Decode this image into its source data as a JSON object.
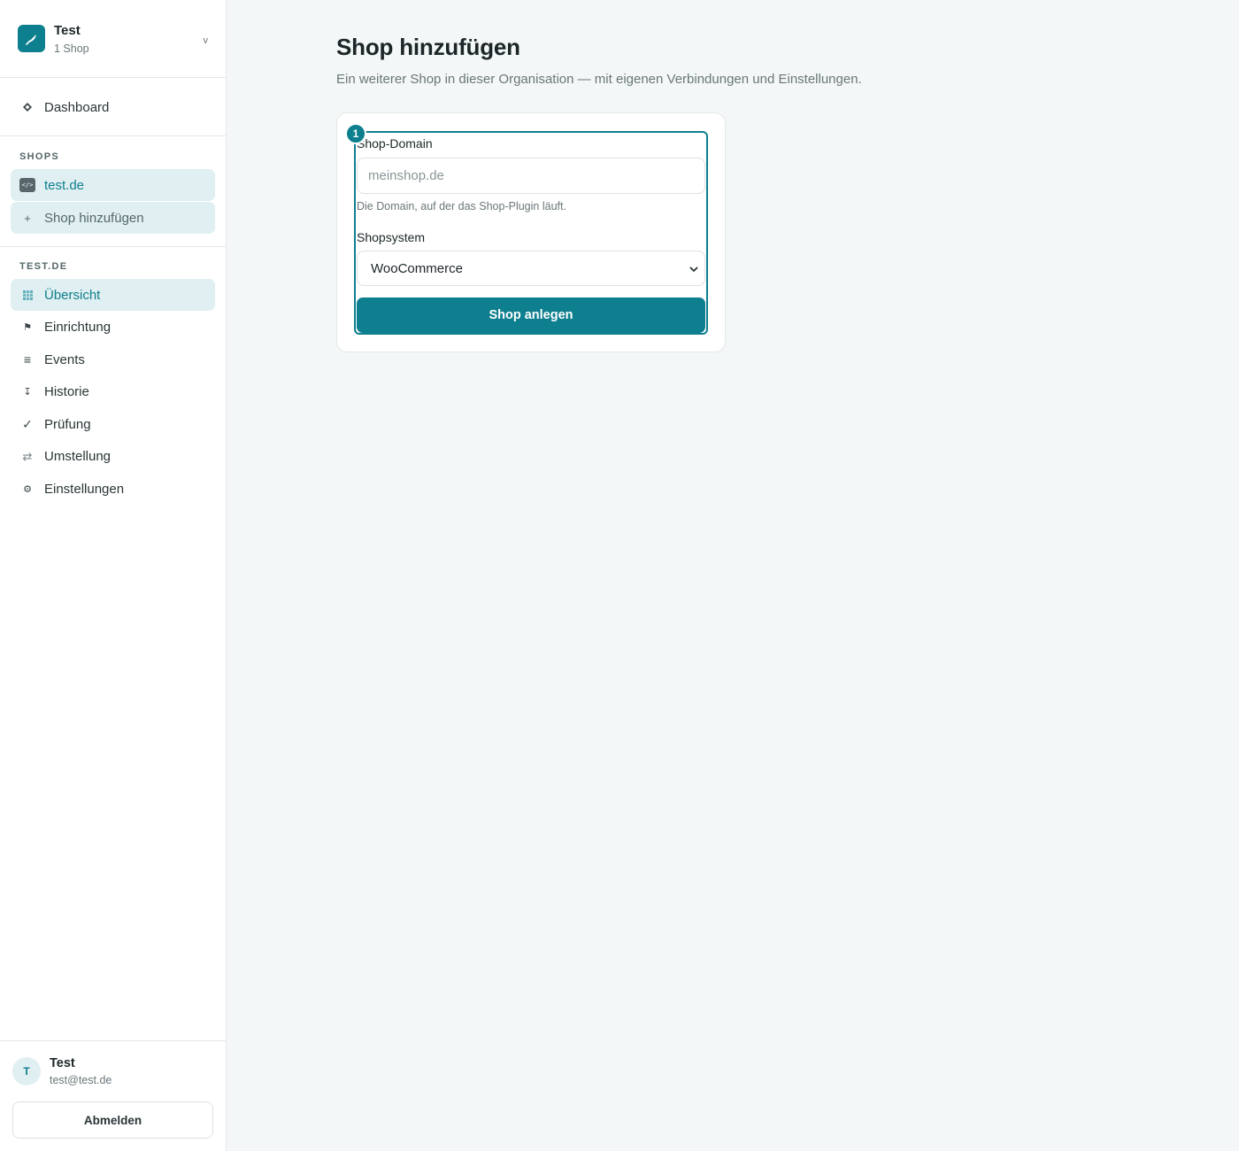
{
  "org": {
    "name": "Test",
    "subtitle": "1 Shop",
    "chevron": "v"
  },
  "nav": {
    "dashboard": {
      "label": "Dashboard",
      "icon": "diamond-icon"
    }
  },
  "shops": {
    "section_label": "SHOPS",
    "items": [
      {
        "label": "test.de",
        "icon": "code-icon",
        "icon_text": "</>"
      },
      {
        "label": "Shop hinzufügen",
        "icon": "plus-icon",
        "icon_text": "+"
      }
    ]
  },
  "shop_nav": {
    "section_label": "TEST.DE",
    "items": [
      {
        "label": "Übersicht",
        "icon": "grid-icon"
      },
      {
        "label": "Einrichtung",
        "icon": "flag-icon",
        "icon_text": "⚑"
      },
      {
        "label": "Events",
        "icon": "list-icon",
        "icon_text": "≡"
      },
      {
        "label": "Historie",
        "icon": "pin-icon",
        "icon_text": "↧"
      },
      {
        "label": "Prüfung",
        "icon": "check-icon",
        "icon_text": "✓"
      },
      {
        "label": "Umstellung",
        "icon": "swap-icon",
        "icon_text": "⇄"
      },
      {
        "label": "Einstellungen",
        "icon": "gear-icon",
        "icon_text": "⚙"
      }
    ]
  },
  "user": {
    "initial": "T",
    "name": "Test",
    "email": "test@test.de",
    "logout_label": "Abmelden"
  },
  "main": {
    "title": "Shop hinzufügen",
    "subtitle": "Ein weiterer Shop in dieser Organisation — mit eigenen Verbindungen und Einstellungen.",
    "step_number": "1",
    "domain_label": "Shop-Domain",
    "domain_placeholder": "meinshop.de",
    "domain_value": "",
    "domain_hint": "Die Domain, auf der das Shop-Plugin läuft.",
    "system_label": "Shopsystem",
    "system_selected": "WooCommerce",
    "submit_label": "Shop anlegen"
  },
  "colors": {
    "accent": "#0e7f8e",
    "active_bg": "#e0eff1",
    "page_bg": "#f3f7f7"
  }
}
